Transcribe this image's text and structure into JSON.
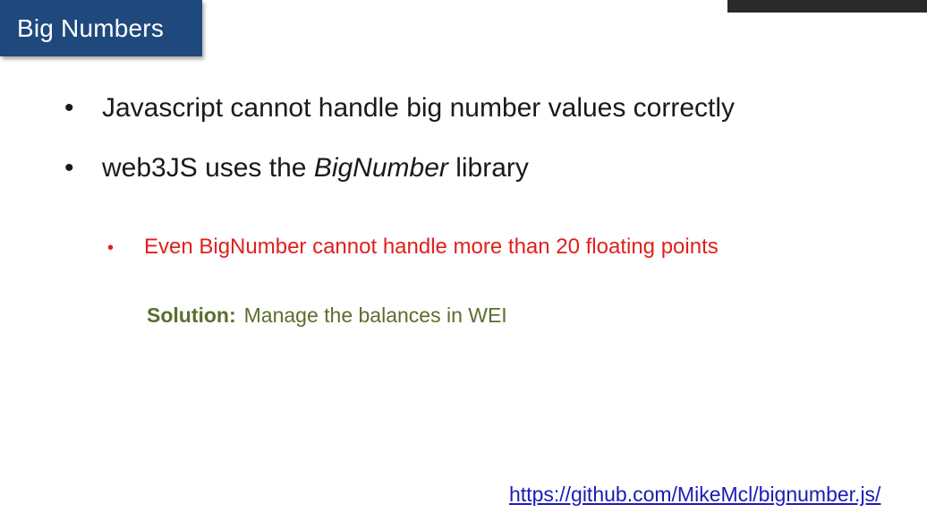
{
  "slide": {
    "title": "Big Numbers",
    "bullets": [
      {
        "marker": "•",
        "text": "Javascript cannot handle big number values correctly"
      },
      {
        "marker": "•",
        "prefix": "web3JS uses the ",
        "emphasis": "BigNumber",
        "suffix": " library"
      }
    ],
    "sub_bullet": {
      "marker": "•",
      "text": "Even BigNumber cannot handle more than 20 floating points"
    },
    "solution": {
      "label": "Solution:",
      "text": "Manage the balances in WEI"
    },
    "link": "https://github.com/MikeMcl/bignumber.js/"
  },
  "colors": {
    "title_background": "#1f497d",
    "title_text": "#ffffff",
    "body_text": "#1a1a1a",
    "warning_text": "#e0201b",
    "solution_text": "#5b6e2e",
    "link_text": "#1c1cb4"
  }
}
